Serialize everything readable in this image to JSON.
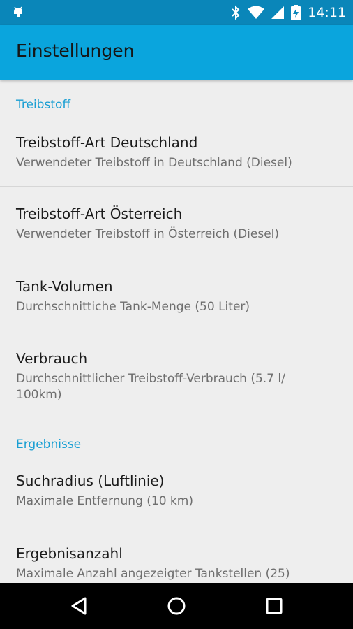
{
  "status_bar": {
    "time": "14:11",
    "icons": [
      "android-notification-icon",
      "bluetooth-icon",
      "wifi-icon",
      "cell-signal-icon",
      "battery-charging-icon"
    ]
  },
  "app_bar": {
    "title": "Einstellungen"
  },
  "sections": [
    {
      "header": "Treibstoff",
      "items": [
        {
          "title": "Treibstoff-Art Deutschland",
          "summary": "Verwendeter Treibstoff in Deutschland (Diesel)"
        },
        {
          "title": "Treibstoff-Art Österreich",
          "summary": "Verwendeter Treibstoff in Österreich (Diesel)"
        },
        {
          "title": "Tank-Volumen",
          "summary": "Durchschnittiche Tank-Menge (50 Liter)"
        },
        {
          "title": "Verbrauch",
          "summary": "Durchschnittlicher Treibstoff-Verbrauch (5.7 l/ 100km)"
        }
      ]
    },
    {
      "header": "Ergebnisse",
      "items": [
        {
          "title": "Suchradius (Luftlinie)",
          "summary": "Maximale Entfernung (10 km)"
        },
        {
          "title": "Ergebnisanzahl",
          "summary": "Maximale Anzahl angezeigter Tankstellen (25)"
        }
      ]
    }
  ],
  "nav_bar": {
    "buttons": [
      "back-icon",
      "home-icon",
      "recents-icon"
    ]
  },
  "colors": {
    "status_bar": "#0a86b9",
    "app_bar": "#0aa5dd",
    "accent": "#1a9fd3",
    "background": "#eeeeee"
  }
}
